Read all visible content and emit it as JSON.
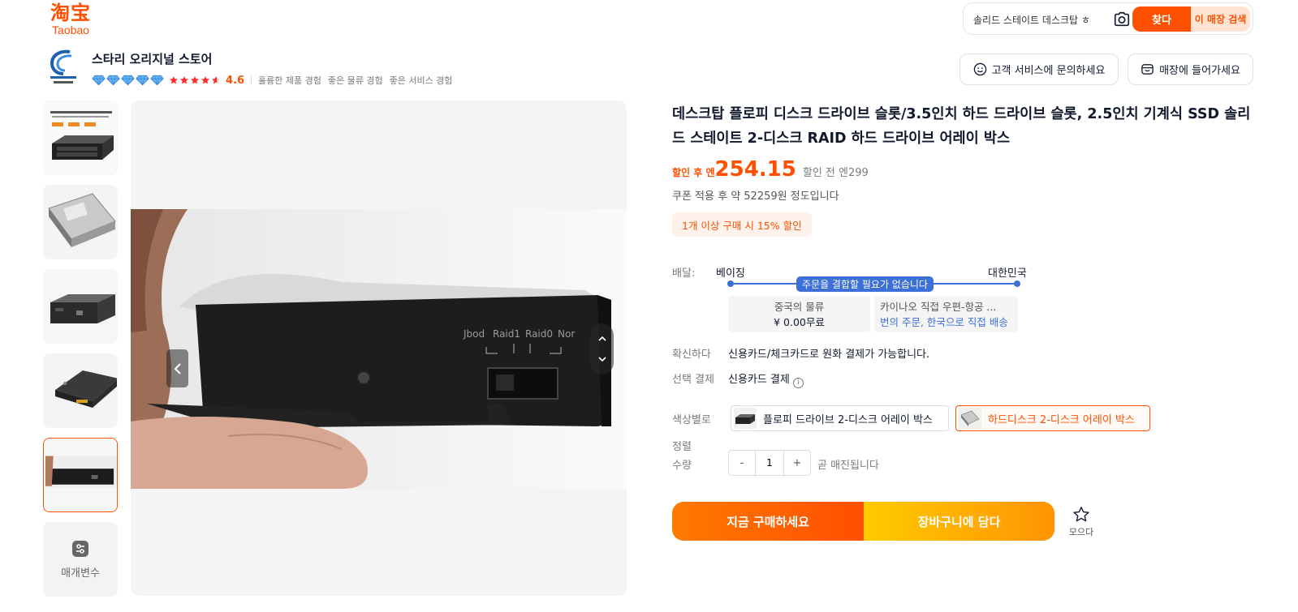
{
  "header": {
    "logo_cn": "淘宝",
    "logo_en": "Taobao",
    "search_value": "솔리드 스테이트 데스크탑 ㅎ",
    "search_button": "찾다",
    "store_search_button": "이 매장 검색"
  },
  "store": {
    "name": "스타리 오리지널 스토어",
    "diamond_count": 5,
    "star_rating": 4.6,
    "rating": "4.6",
    "experiences": [
      "훌륭한 제품 경험",
      "좋은 물류 경험",
      "좋은 서비스 경험"
    ],
    "customer_service_button": "고객 서비스에 문의하세요",
    "enter_store_button": "매장에 들어가세요"
  },
  "gallery": {
    "thumbnail_count": 5,
    "active_index": 4,
    "params_label": "매개변수",
    "photo_port_labels": [
      "Jbod",
      "Raid1",
      "Raid0",
      "Nor"
    ]
  },
  "product": {
    "title": "데스크탑 플로피 디스크 드라이브 슬롯/3.5인치 하드 드라이브 슬롯, 2.5인치 기계식 SSD 솔리드 스테이트 2-디스크 RAID 하드 드라이브 어레이 박스",
    "price_label": "할인 후 엔",
    "price": "254.15",
    "original_price": "할인 전 엔299",
    "coupon_note": "쿠폰 적용 후 약 52259원 정도입니다",
    "discount_badge": "1개 이상 구매 시 15% 할인"
  },
  "shipping": {
    "label": "배달:",
    "from": "베이징",
    "to": "대한민국",
    "badge": "주문을 결합할 필요가 없습니다",
    "left_box_title": "중국의 물류",
    "left_box_price": "¥ 0.00무료",
    "right_box_title": "카이나오 직접 우편-항공 ...",
    "right_box_link": "번의 주문, 한국으로 직접 배송"
  },
  "payment": {
    "confirm_label": "확신하다",
    "confirm_value": "신용카드/체크카드로 원화 결제가 가능합니다.",
    "method_label": "선택 결제",
    "method_value": "신용카드 결제",
    "info_icon": "i"
  },
  "options": {
    "color_label": "색상별로",
    "items": [
      {
        "label": "플로피 드라이브 2-디스크 어레이 박스",
        "selected": false
      },
      {
        "label": "하드디스크 2-디스크 어레이 박스",
        "selected": true
      }
    ],
    "sort_label": "정렬",
    "qty_label": "수량",
    "qty_dec": "-",
    "qty_value": "1",
    "qty_inc": "+",
    "stock_note": "곧 매진됩니다"
  },
  "actions": {
    "buy_now": "지금 구매하세요",
    "add_to_cart": "장바구니에 담다",
    "favorite": "모으다"
  },
  "colors": {
    "accent": "#ff5000",
    "link_blue": "#3c6fd8",
    "cart_yellow": "#ffb700"
  }
}
